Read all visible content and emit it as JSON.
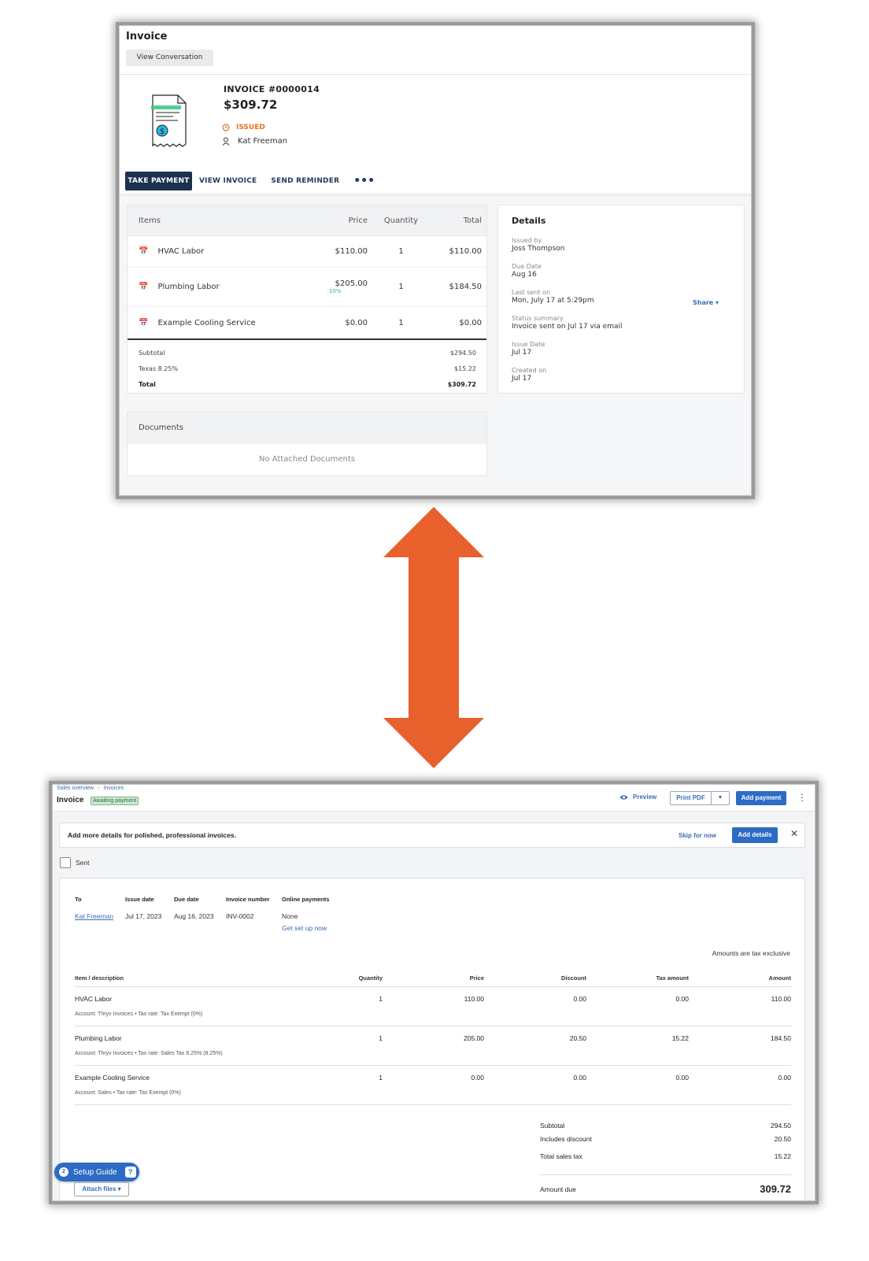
{
  "top": {
    "title": "Invoice",
    "view_conversation": "View Conversation",
    "invoice_number": "INVOICE #0000014",
    "amount": "$309.72",
    "status": "ISSUED",
    "customer": "Kat Freeman",
    "tabs": [
      "TAKE PAYMENT",
      "VIEW INVOICE",
      "SEND REMINDER",
      "•••"
    ],
    "items_header": {
      "item": "Items",
      "price": "Price",
      "quantity": "Quantity",
      "total": "Total"
    },
    "items": [
      {
        "name": "HVAC Labor",
        "price": "$110.00",
        "discount": "",
        "quantity": "1",
        "total": "$110.00"
      },
      {
        "name": "Plumbing Labor",
        "price": "$205.00",
        "discount": "-10%",
        "quantity": "1",
        "total": "$184.50"
      },
      {
        "name": "Example Cooling Service",
        "price": "$0.00",
        "discount": "",
        "quantity": "1",
        "total": "$0.00"
      }
    ],
    "summary": [
      {
        "label": "Subtotal",
        "value": "$294.50"
      },
      {
        "label": "Texas 8.25%",
        "value": "$15.22"
      },
      {
        "label": "Total",
        "value": "$309.72"
      }
    ],
    "details_title": "Details",
    "details": [
      {
        "label": "Issued by",
        "value": "Joss Thompson"
      },
      {
        "label": "Due Date",
        "value": "Aug 16"
      },
      {
        "label": "Last sent on",
        "value": "Mon, July 17 at 5:29pm"
      },
      {
        "label": "Status summary",
        "value": "Invoice sent on Jul 17 via email"
      },
      {
        "label": "Issue Date",
        "value": "Jul 17"
      },
      {
        "label": "Created on",
        "value": "Jul 17"
      }
    ],
    "share": "Share ▾",
    "documents_title": "Documents",
    "documents_empty": "No Attached Documents",
    "colors": {
      "navy": "#1c3150",
      "issued": "#e07424",
      "discount": "#3cb371",
      "link": "#3a6db5"
    }
  },
  "arrow": {
    "color": "#e8602c"
  },
  "bottom": {
    "breadcrumb": [
      "Sales overview",
      "Invoices"
    ],
    "title": "Invoice",
    "badge": "Awaiting payment",
    "preview": "Preview",
    "print_pdf": "Print PDF",
    "add_payment": "Add payment",
    "banner_text": "Add more details for polished, professional invoices.",
    "skip": "Skip for now",
    "add_details": "Add details",
    "sent_label": "Sent",
    "meta": {
      "to_label": "To",
      "to_value": "Kat Freeman",
      "issue_label": "Issue date",
      "issue_value": "Jul 17, 2023",
      "due_label": "Due date",
      "due_value": "Aug 16, 2023",
      "number_label": "Invoice number",
      "number_value": "INV-0002",
      "online_label": "Online payments",
      "online_value": "None",
      "get_set_up": "Get set up now"
    },
    "tax_note": "Amounts are tax exclusive",
    "columns": [
      "Item / description",
      "Quantity",
      "Price",
      "Discount",
      "Tax amount",
      "Amount"
    ],
    "lines": [
      {
        "name": "HVAC Labor",
        "account": "Account: Thryv Invoices • Tax rate: Tax Exempt (0%)",
        "qty": "1",
        "price": "110.00",
        "discount": "0.00",
        "tax": "0.00",
        "amount": "110.00"
      },
      {
        "name": "Plumbing Labor",
        "account": "Account: Thryv Invoices • Tax rate: Sales Tax 8.25% (8.25%)",
        "qty": "1",
        "price": "205.00",
        "discount": "20.50",
        "tax": "15.22",
        "amount": "184.50"
      },
      {
        "name": "Example Cooling Service",
        "account": "Account: Sales • Tax rate: Tax Exempt (0%)",
        "qty": "1",
        "price": "0.00",
        "discount": "0.00",
        "tax": "0.00",
        "amount": "0.00"
      }
    ],
    "totals": [
      {
        "label": "Subtotal",
        "value": "294.50"
      },
      {
        "label": "Includes discount",
        "value": "20.50"
      },
      {
        "label": "Total sales tax",
        "value": "15.22"
      }
    ],
    "amount_due_label": "Amount due",
    "amount_due_value": "309.72",
    "setup_guide": "Setup Guide",
    "setup_count": "2",
    "attach_files": "Attach files ▾",
    "colors": {
      "primary": "#2d6bc4",
      "badge_bg": "#cfe8d4"
    }
  }
}
